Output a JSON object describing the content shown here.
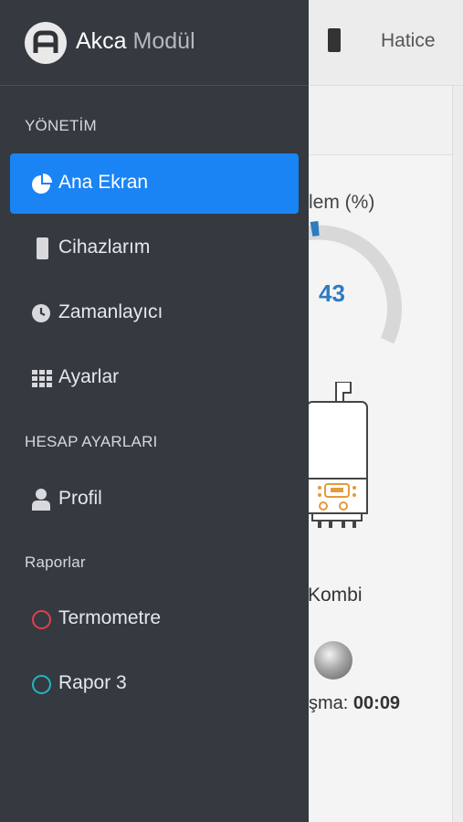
{
  "colors": {
    "drawer_bg": "#353a40",
    "active_bg": "#1a84f4",
    "gauge_accent": "#2f7bbf",
    "termometre_ring": "#e0414a",
    "rapor3_ring": "#1fb7c1"
  },
  "topbar": {
    "device_icon": "mobile-phone-icon",
    "user_name": "Hatice"
  },
  "main": {
    "gauge_title": "lem (%)",
    "gauge_value": "43",
    "gauge_percent": 43,
    "device_label": "Kombi",
    "timer_prefix": "şma:",
    "timer_value": "00:09"
  },
  "drawer": {
    "brand_bold": "Akca",
    "brand_light": "Modül",
    "logo_letter": "A",
    "sections": {
      "yonetim": "YÖNETİM",
      "hesap": "HESAP AYARLARI",
      "raporlar": "Raporlar"
    },
    "items": [
      {
        "label": "Ana Ekran",
        "icon": "pie-chart-icon",
        "active": true
      },
      {
        "label": "Cihazlarım",
        "icon": "mobile-phone-icon",
        "active": false
      },
      {
        "label": "Zamanlayıcı",
        "icon": "clock-icon",
        "active": false
      },
      {
        "label": "Ayarlar",
        "icon": "grid-icon",
        "active": false
      },
      {
        "label": "Profil",
        "icon": "user-icon",
        "active": false
      },
      {
        "label": "Termometre",
        "icon": "circle-icon",
        "active": false
      },
      {
        "label": "Rapor 3",
        "icon": "circle-icon",
        "active": false
      }
    ]
  }
}
